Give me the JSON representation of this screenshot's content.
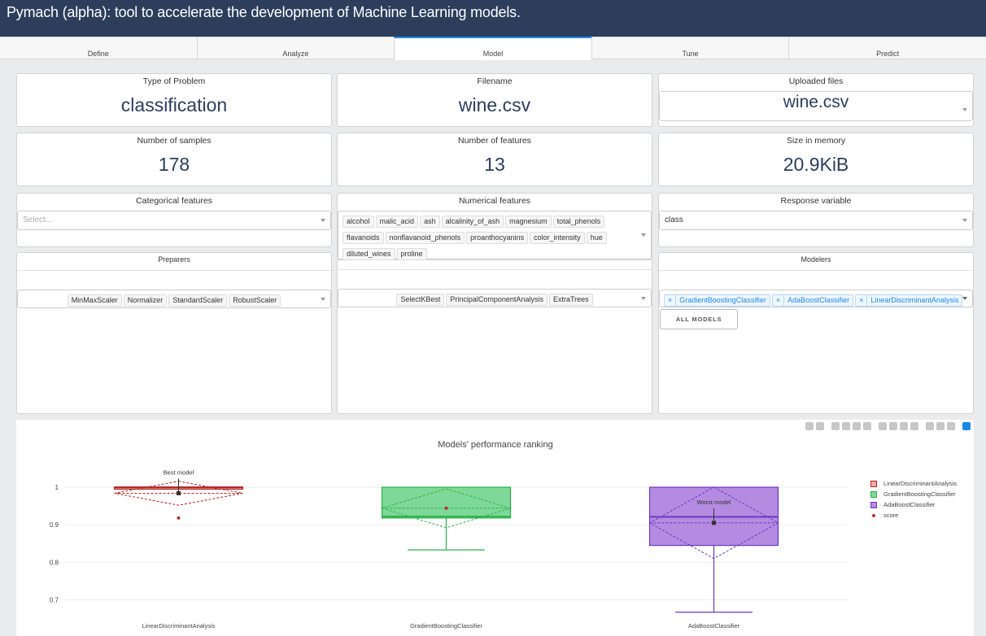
{
  "app": {
    "title": "Pymach (alpha): tool to accelerate the development of Machine Learning models."
  },
  "tabs": [
    {
      "label": "Define"
    },
    {
      "label": "Analyze"
    },
    {
      "label": "Model",
      "active": true
    },
    {
      "label": "Tune"
    },
    {
      "label": "Predict"
    }
  ],
  "cards": {
    "type_of_problem": {
      "label": "Type of Problem",
      "value": "classification"
    },
    "filename": {
      "label": "Filename",
      "value": "wine.csv"
    },
    "uploaded_files": {
      "label": "Uploaded files",
      "value": "wine.csv"
    },
    "samples": {
      "label": "Number of samples",
      "value": "178"
    },
    "features": {
      "label": "Number of features",
      "value": "13"
    },
    "memory": {
      "label": "Size in memory",
      "value": "20.9KiB"
    }
  },
  "categorical": {
    "label": "Categorical features",
    "placeholder": "Select..."
  },
  "numerical": {
    "label": "Numerical features",
    "items": [
      "alcohol",
      "malic_acid",
      "ash",
      "alcalinity_of_ash",
      "magnesium",
      "total_phenols",
      "flavanoids",
      "nonflavanoid_phenols",
      "proanthocyanins",
      "color_intensity",
      "hue",
      "diluted_wines",
      "proline"
    ]
  },
  "response": {
    "label": "Response variable",
    "value": "class"
  },
  "preparers": {
    "label": "Preparers",
    "scalers": [
      "MinMaxScaler",
      "Normalizer",
      "StandardScaler",
      "RobustScaler"
    ],
    "selectors": [
      "SelectKBest",
      "PrincipalComponentAnalysis",
      "ExtraTrees"
    ]
  },
  "modelers": {
    "label": "Modelers",
    "selected": [
      "GradientBoostingClassifier",
      "AdaBoostClassifier",
      "LinearDiscriminantAnalysis"
    ],
    "remove_symbol": "×",
    "all_button": "ALL MODELS"
  },
  "chart_data": {
    "type": "box",
    "title": "Models' performance ranking",
    "xlabel": "",
    "ylabel": "",
    "ylim": [
      0.66,
      1.05
    ],
    "yticks": [
      0.7,
      0.8,
      0.9,
      1
    ],
    "grid": true,
    "legend_position": "right",
    "series": [
      {
        "name": "LinearDiscriminantAnalysis",
        "color": "#b22222",
        "fill": "#f2a9a9",
        "q1": 0.995,
        "median": 1.0,
        "q3": 1.0,
        "min": 0.995,
        "max": 1.0,
        "mean": 0.984,
        "sd": 0.032,
        "outliers": [
          0.918
        ],
        "annotation": "Best model"
      },
      {
        "name": "GradientBoostingClassifier",
        "color": "#2bb24c",
        "fill": "#7ed897",
        "q1": 0.918,
        "median": 0.922,
        "q3": 1.0,
        "min": 0.833,
        "max": 1.0,
        "mean": 0.944,
        "sd": 0.052,
        "outliers": [],
        "annotation": ""
      },
      {
        "name": "AdaBoostClassifier",
        "color": "#6a38c2",
        "fill": "#b48be0",
        "q1": 0.845,
        "median": 0.921,
        "q3": 1.0,
        "min": 0.667,
        "max": 1.0,
        "mean": 0.905,
        "sd": 0.095,
        "outliers": [],
        "annotation": "Worst model"
      }
    ],
    "score_legend": "score",
    "score_color": "#c0292f"
  }
}
